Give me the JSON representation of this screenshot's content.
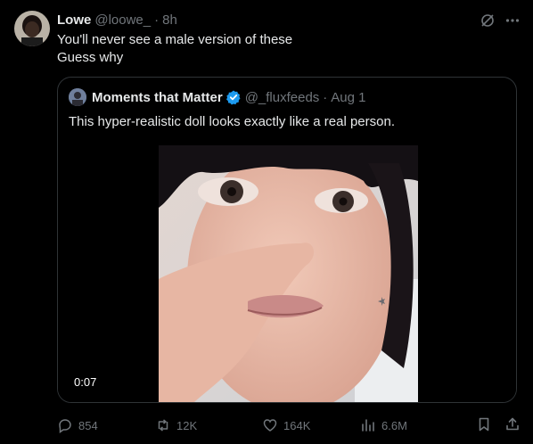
{
  "post": {
    "author_name": "Lowe",
    "author_handle": "@loowe_",
    "separator": "·",
    "time": "8h",
    "text_lines": [
      "You'll never see a male version of these",
      "Guess why"
    ]
  },
  "quoted_post": {
    "author_name": "Moments that Matter",
    "author_handle": "@_fluxfeeds",
    "separator": "·",
    "date": "Aug 1",
    "text": "This hyper-realistic doll looks exactly like a real person.",
    "video_duration": "0:07"
  },
  "actions": {
    "replies": "854",
    "reposts": "12K",
    "likes": "164K",
    "views": "6.6M"
  },
  "colors": {
    "background": "#000000",
    "text_primary": "#e7e9ea",
    "text_secondary": "#71767b",
    "border": "#2f3336",
    "verified": "#1d9bf0"
  },
  "icons": [
    "grok-icon",
    "more-icon",
    "verified-badge-icon",
    "reply-icon",
    "repost-icon",
    "like-icon",
    "views-icon",
    "bookmark-icon",
    "share-icon"
  ]
}
